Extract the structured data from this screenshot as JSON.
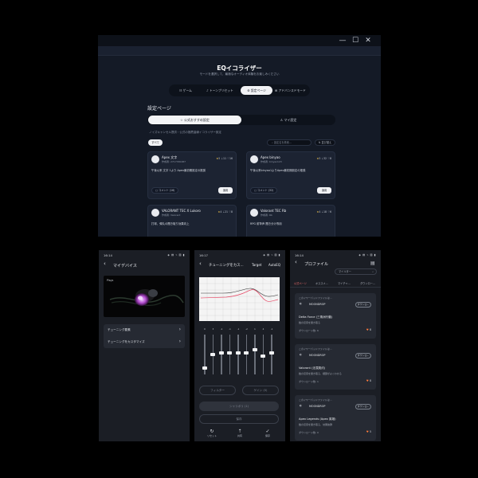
{
  "desktop": {
    "window_controls": [
      "—",
      "☐",
      "✕"
    ],
    "title": "EQイコライザー",
    "subtitle": "モードを選択して、最適なオーディオ体験をお楽しみください",
    "tabs": [
      {
        "icon": "☷",
        "label": "ゲーム"
      },
      {
        "icon": "♪",
        "label": "トーンプリセット"
      },
      {
        "icon": "⚙",
        "label": "設定ページ"
      },
      {
        "icon": "⊞",
        "label": "アドバンスドモード"
      }
    ],
    "active_tab": 2,
    "section_title": "設定ページ",
    "segments": [
      {
        "icon": "☆",
        "label": "公式おすすめ設定"
      },
      {
        "icon": "♙",
        "label": "マイ設定"
      }
    ],
    "hint": "ノイズキャンセル提供・公式の推薦曲線イコライザー設定",
    "filter_chip": "すべて",
    "search_placeholder": "設定名を検索...",
    "sort_label": "並び替え",
    "cards": [
      {
        "name": "Apex 文字",
        "author": "作成者: 2717330487",
        "rating": "5",
        "downloads": "11",
        "likes": "16",
        "desc": "午後以来 文字 1より Apex最初期設定の推奨",
        "comment": "コメント (16)",
        "apply": "適用"
      },
      {
        "name": "Apex binyao",
        "author": "作成者: binyao123",
        "rating": "5",
        "downloads": "32",
        "likes": "8",
        "desc": "午後以来binyao1よりApex最初期設定の推奨",
        "comment": "コメント (32)",
        "apply": "適用"
      },
      {
        "name": "VALORANT TEC X Lukoro",
        "author": "作成者: Valorant",
        "rating": "4",
        "downloads": "21",
        "likes": "8",
        "desc": "打球、弾丸の聞き取り効果向上",
        "comment": "コメント (21)",
        "apply": "適用"
      },
      {
        "name": "Valorant TEC Rb",
        "author": "作成者: Rb",
        "rating": "4",
        "downloads": "18",
        "likes": "6",
        "desc": "RPG 射撃声 聞き分け専用",
        "comment": "コメント (18)",
        "apply": "適用"
      }
    ]
  },
  "phone1": {
    "time": "16:14",
    "status_icons": "◈ ▤ ⌁ ▥ ▮",
    "title": "マイデバイス",
    "device_tag": "Plays",
    "menu": [
      "チューニング要素",
      "チューニングをカスタマイズ"
    ]
  },
  "phone2": {
    "time": "16:17",
    "status_icons": "◈ ▤ ⌁ ▥ ▮",
    "title": "チューニングをカス...",
    "target_label": "Target",
    "autoeq_label": "AutoEQ",
    "db_labels": [
      "0",
      "3",
      "-1",
      "-1",
      "-1",
      "-2",
      "1",
      "4",
      "-1"
    ],
    "band_values": [
      -8,
      0,
      1,
      1,
      1,
      1,
      3,
      -1,
      1
    ],
    "btn_filter": "フィルター",
    "btn_gain": "ゲイン (0)",
    "btn_curve": "シャリボリ (1)",
    "btn_save_curve": "保存",
    "bottom": [
      {
        "icon": "↻",
        "label": "リセット"
      },
      {
        "icon": "⇡",
        "label": "共有"
      },
      {
        "icon": "✓",
        "label": "保存"
      }
    ]
  },
  "phone3": {
    "time": "16:14",
    "status_icons": "◈ ▤ ⌁ ▥ ▮",
    "title": "プロファイル",
    "search_placeholder": "マイルター",
    "tabs": [
      "公式ページ",
      "オススメ...",
      "マイチャ...",
      "ダウンロー..."
    ],
    "active_tab": 0,
    "cards": [
      {
        "head": "このイヤーパッドファイルは...",
        "brand": "MOONDROP",
        "follow": "ダウンロ...",
        "name": "Delta Force (三角洲行動)",
        "desc": "敵の足音を聞き取る",
        "count": "ダウンロード数: 6",
        "likes": "8"
      },
      {
        "head": "このイヤーパッドファイルは...",
        "brand": "MOONDROP",
        "follow": "ダウンロ...",
        "name": "Valorant (无畏契约)",
        "desc": "敵の足音を聞き取る、細部がよくわかる",
        "count": "ダウンロード数: 1",
        "likes": "8"
      },
      {
        "head": "このイヤーパッドファイルは...",
        "brand": "MOONDROP",
        "follow": "ダウンロ...",
        "name": "Apex Legends (Apex 英雄)",
        "desc": "敵の足音を聞き取る、効果抜群",
        "count": "ダウンロード数: 0",
        "likes": "5"
      }
    ]
  }
}
